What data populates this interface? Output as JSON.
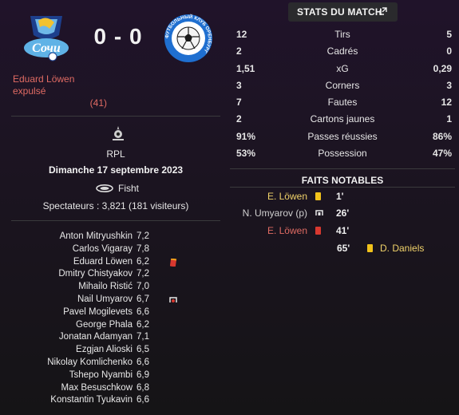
{
  "match": {
    "home_goals": "0",
    "away_goals": "0",
    "score_sep": "-",
    "home_logo_text": "Сочи",
    "away_logo_text": "ФУТБОЛЬНЫЙ КЛУБ ОРЕНБУРГ",
    "red_card_note": "Eduard Löwen expulsé",
    "red_card_minute": "(41)"
  },
  "info": {
    "competition": "RPL",
    "date": "Dimanche 17 septembre 2023",
    "venue": "Fisht",
    "attendance": "Spectateurs : 3,821 (181 visiteurs)"
  },
  "players": [
    {
      "name": "Anton Mitryushkin",
      "rating": "7,2",
      "icon": ""
    },
    {
      "name": "Carlos Vigaray",
      "rating": "7,8",
      "icon": ""
    },
    {
      "name": "Eduard Löwen",
      "rating": "6,2",
      "icon": "red-card"
    },
    {
      "name": "Dmitry Chistyakov",
      "rating": "7,2",
      "icon": ""
    },
    {
      "name": "Mihailo Ristić",
      "rating": "7,0",
      "icon": ""
    },
    {
      "name": "Nail Umyarov",
      "rating": "6,7",
      "icon": "penalty-miss"
    },
    {
      "name": "Pavel Mogilevets",
      "rating": "6,6",
      "icon": ""
    },
    {
      "name": "George Phala",
      "rating": "6,2",
      "icon": ""
    },
    {
      "name": "Jonatan Adamyan",
      "rating": "7,1",
      "icon": ""
    },
    {
      "name": "Ezgjan Alioski",
      "rating": "6,5",
      "icon": ""
    },
    {
      "name": "Nikolay Komlichenko",
      "rating": "6,6",
      "icon": ""
    },
    {
      "name": "Tshepo Nyambi",
      "rating": "6,9",
      "icon": ""
    },
    {
      "name": "Max Besuschkow",
      "rating": "6,8",
      "icon": ""
    },
    {
      "name": "Konstantin Tyukavin",
      "rating": "6,6",
      "icon": ""
    }
  ],
  "stats_tab": {
    "label": "STATS DU MATCH",
    "icon": "expand-icon"
  },
  "stats": [
    {
      "home": "12",
      "label": "Tirs",
      "away": "5"
    },
    {
      "home": "2",
      "label": "Cadrés",
      "away": "0"
    },
    {
      "home": "1,51",
      "label": "xG",
      "away": "0,29"
    },
    {
      "home": "3",
      "label": "Corners",
      "away": "3"
    },
    {
      "home": "7",
      "label": "Fautes",
      "away": "12"
    },
    {
      "home": "2",
      "label": "Cartons jaunes",
      "away": "1"
    },
    {
      "home": "91%",
      "label": "Passes réussies",
      "away": "86%"
    },
    {
      "home": "53%",
      "label": "Possession",
      "away": "47%"
    }
  ],
  "notable": {
    "title": "FAITS NOTABLES",
    "events": [
      {
        "player": "E. Löwen",
        "minute": "1'",
        "type": "yellow-card",
        "side": "home"
      },
      {
        "player": "N. Umyarov (p)",
        "minute": "26'",
        "type": "penalty-miss",
        "side": "home"
      },
      {
        "player": "E. Löwen",
        "minute": "41'",
        "type": "red-card",
        "side": "home"
      },
      {
        "player": "D. Daniels",
        "minute": "65'",
        "type": "yellow-card",
        "side": "away"
      }
    ]
  },
  "colors": {
    "red_text": "#e06b63",
    "yellow_text": "#f1d36a",
    "yellow_card": "#f1c21b",
    "red_card": "#d8382f",
    "bg_top": "#20132a"
  }
}
